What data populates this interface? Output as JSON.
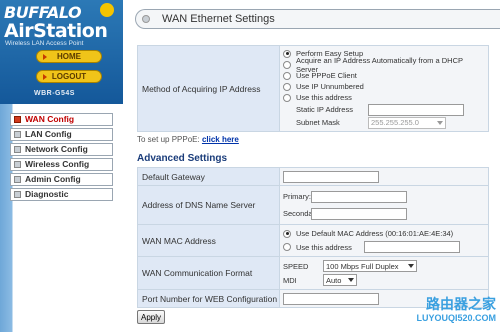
{
  "sidebar": {
    "brand": "BUFFALO",
    "product": "AirStation",
    "tagline": "Wireless LAN Access Point",
    "home_label": "HOME",
    "logout_label": "LOGOUT",
    "model": "WBR-G54S",
    "items": [
      {
        "label": "WAN Config",
        "active": true
      },
      {
        "label": "LAN Config",
        "active": false
      },
      {
        "label": "Network Config",
        "active": false
      },
      {
        "label": "Wireless Config",
        "active": false
      },
      {
        "label": "Admin Config",
        "active": false
      },
      {
        "label": "Diagnostic",
        "active": false
      }
    ]
  },
  "main": {
    "title": "WAN Ethernet Settings",
    "ip_method": {
      "label": "Method of Acquiring IP Address",
      "options": [
        {
          "label": "Perform Easy Setup",
          "checked": true
        },
        {
          "label": "Acquire an IP Address Automatically from a DHCP Server",
          "checked": false
        },
        {
          "label": "Use PPPoE Client",
          "checked": false
        },
        {
          "label": "Use IP Unnumbered",
          "checked": false
        },
        {
          "label": "Use this address",
          "checked": false
        }
      ],
      "static_ip_label": "Static IP Address",
      "static_ip_value": "",
      "subnet_label": "Subnet Mask",
      "subnet_value": "255.255.255.0"
    },
    "pppoe_text": "To set up PPPoE:",
    "pppoe_link": "click here",
    "advanced_heading": "Advanced Settings",
    "default_gateway": {
      "label": "Default Gateway",
      "value": ""
    },
    "dns": {
      "label": "Address of DNS Name Server",
      "primary_label": "Primary:",
      "primary_value": "",
      "secondary_label": "Secondary:",
      "secondary_value": ""
    },
    "wan_mac": {
      "label": "WAN MAC Address",
      "default_option": "Use Default MAC Address (00:16:01:AE:4E:34)",
      "default_checked": true,
      "custom_option": "Use this address",
      "custom_value": ""
    },
    "comm_format": {
      "label": "WAN Communication Format",
      "speed_label": "SPEED",
      "speed_value": "100 Mbps Full Duplex",
      "mdi_label": "MDI",
      "mdi_value": "Auto"
    },
    "web_port": {
      "label": "Port Number for WEB Configuration",
      "value": ""
    },
    "apply_label": "Apply"
  },
  "watermark": {
    "cn": "路由器之家",
    "en": "LUYOUQI520.COM"
  }
}
